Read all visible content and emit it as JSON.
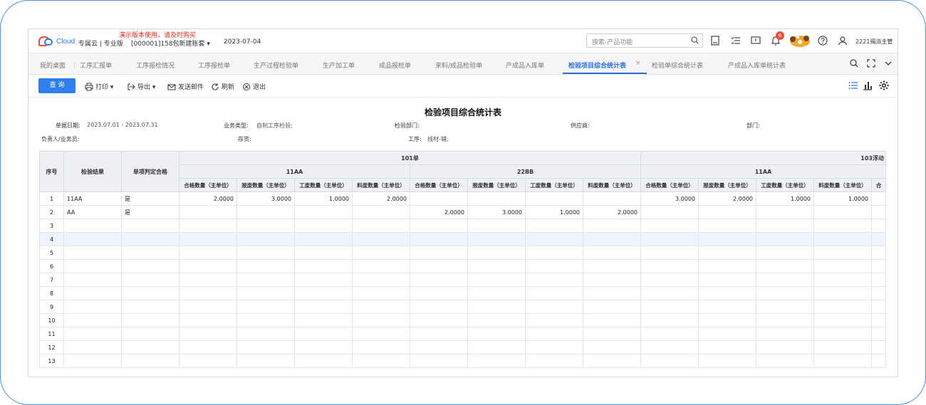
{
  "header": {
    "logo_text": "Cloud",
    "edition": "专属云 | 专业版",
    "demo_warning": "演示版本使用，请及时购买",
    "account": "[000001]158包新建账套 ▾",
    "date": "2023-07-04",
    "search_placeholder": "搜索-产品功能",
    "notification_count": "6",
    "user": "2221揭派主管"
  },
  "tabs": [
    {
      "label": "我的桌面"
    },
    {
      "label": "工序汇报单"
    },
    {
      "label": "工序报检情况"
    },
    {
      "label": "工序报检单"
    },
    {
      "label": "生产过程检验单"
    },
    {
      "label": "生产加工单"
    },
    {
      "label": "成品报检单"
    },
    {
      "label": "来料/成品检验单"
    },
    {
      "label": "产成品入库单"
    },
    {
      "label": "检验项目综合统计表"
    },
    {
      "label": "检验单综合统计表"
    },
    {
      "label": "产成品入库单统计表"
    }
  ],
  "toolbar": {
    "query": "查 询",
    "print": "打印 ▾",
    "export": "导出 ▾",
    "email": "发送邮件",
    "refresh": "刷新",
    "exit": "退出"
  },
  "report": {
    "title": "检验项目综合统计表",
    "filters": {
      "date_label": "单据日期:",
      "date_value": "2023.07.01 - 2023.07.31",
      "biz_label": "业务类型:",
      "biz_value": "自制工序检验;",
      "dept_inspect_label": "检验部门:",
      "supplier_label": "供应商:",
      "dept_label": "部门:",
      "person_label": "负责人/业务员:",
      "stock_label": "存货:",
      "process_label": "工序:",
      "process_value": "线材-辅;"
    },
    "grid": {
      "col_index": "序号",
      "col_result": "检验结果",
      "col_judge": "单项判定合格",
      "group1": "101单",
      "group2": "103浮动",
      "sub1": "11AA",
      "sub2": "22BB",
      "sub3": "11AA",
      "metric1": "合格数量（主单位）",
      "metric2": "报废数量（主单位）",
      "metric3": "工废数量（主单位）",
      "metric4": "料废数量（主单位）",
      "metric_cut": "合",
      "rows": [
        {
          "idx": "1",
          "result": "11AA",
          "judge": "是",
          "v": [
            "2.0000",
            "3.0000",
            "1.0000",
            "2.0000",
            "",
            "",
            "",
            "",
            "3.0000",
            "2.0000",
            "1.0000",
            "1.0000"
          ]
        },
        {
          "idx": "2",
          "result": "AA",
          "judge": "是",
          "v": [
            "",
            "",
            "",
            "",
            "2.0000",
            "3.0000",
            "1.0000",
            "2.0000",
            "",
            "",
            "",
            ""
          ]
        },
        {
          "idx": "3",
          "result": "",
          "judge": "",
          "v": [
            "",
            "",
            "",
            "",
            "",
            "",
            "",
            "",
            "",
            "",
            "",
            ""
          ]
        },
        {
          "idx": "4",
          "result": "",
          "judge": "",
          "v": [
            "",
            "",
            "",
            "",
            "",
            "",
            "",
            "",
            "",
            "",
            "",
            ""
          ]
        },
        {
          "idx": "5",
          "result": "",
          "judge": "",
          "v": [
            "",
            "",
            "",
            "",
            "",
            "",
            "",
            "",
            "",
            "",
            "",
            ""
          ]
        },
        {
          "idx": "6",
          "result": "",
          "judge": "",
          "v": [
            "",
            "",
            "",
            "",
            "",
            "",
            "",
            "",
            "",
            "",
            "",
            ""
          ]
        },
        {
          "idx": "7",
          "result": "",
          "judge": "",
          "v": [
            "",
            "",
            "",
            "",
            "",
            "",
            "",
            "",
            "",
            "",
            "",
            ""
          ]
        },
        {
          "idx": "8",
          "result": "",
          "judge": "",
          "v": [
            "",
            "",
            "",
            "",
            "",
            "",
            "",
            "",
            "",
            "",
            "",
            ""
          ]
        },
        {
          "idx": "9",
          "result": "",
          "judge": "",
          "v": [
            "",
            "",
            "",
            "",
            "",
            "",
            "",
            "",
            "",
            "",
            "",
            ""
          ]
        },
        {
          "idx": "10",
          "result": "",
          "judge": "",
          "v": [
            "",
            "",
            "",
            "",
            "",
            "",
            "",
            "",
            "",
            "",
            "",
            ""
          ]
        },
        {
          "idx": "11",
          "result": "",
          "judge": "",
          "v": [
            "",
            "",
            "",
            "",
            "",
            "",
            "",
            "",
            "",
            "",
            "",
            ""
          ]
        },
        {
          "idx": "12",
          "result": "",
          "judge": "",
          "v": [
            "",
            "",
            "",
            "",
            "",
            "",
            "",
            "",
            "",
            "",
            "",
            ""
          ]
        },
        {
          "idx": "13",
          "result": "",
          "judge": "",
          "v": [
            "",
            "",
            "",
            "",
            "",
            "",
            "",
            "",
            "",
            "",
            "",
            ""
          ]
        }
      ]
    }
  }
}
